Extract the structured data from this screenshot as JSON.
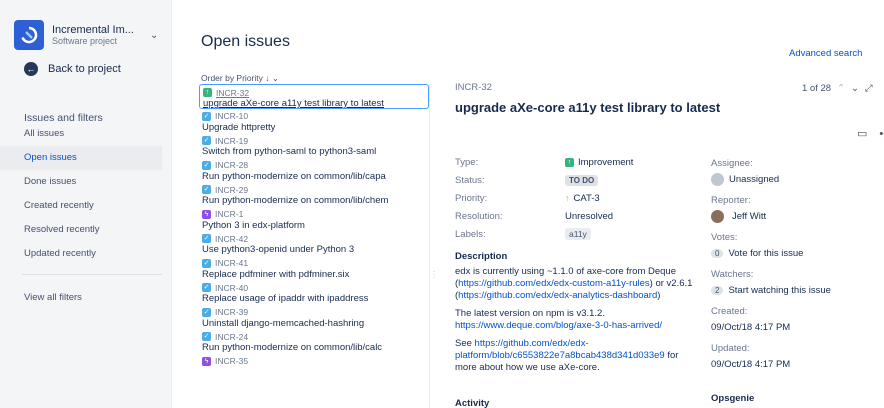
{
  "sidebar": {
    "project_name": "Incremental Im...",
    "project_type": "Software project",
    "back_label": "Back to project",
    "heading": "Issues and filters",
    "items": [
      {
        "label": "All issues",
        "active": false
      },
      {
        "label": "Open issues",
        "active": true
      },
      {
        "label": "Done issues",
        "active": false
      },
      {
        "label": "Created recently",
        "active": false
      },
      {
        "label": "Resolved recently",
        "active": false
      },
      {
        "label": "Updated recently",
        "active": false
      }
    ],
    "view_all": "View all filters"
  },
  "main": {
    "title": "Open issues",
    "advanced_search": "Advanced search",
    "order_by": "Order by Priority ↓ ⌄"
  },
  "issues": [
    {
      "key": "INCR-32",
      "summary": "upgrade aXe-core a11y test library to latest",
      "type": "improvement"
    },
    {
      "key": "INCR-10",
      "summary": "Upgrade httpretty",
      "type": "task"
    },
    {
      "key": "INCR-19",
      "summary": "Switch from python-saml to python3-saml",
      "type": "task"
    },
    {
      "key": "INCR-28",
      "summary": "Run python-modernize on common/lib/capa",
      "type": "task"
    },
    {
      "key": "INCR-29",
      "summary": "Run python-modernize on common/lib/chem",
      "type": "task"
    },
    {
      "key": "INCR-1",
      "summary": "Python 3 in edx-platform",
      "type": "epic"
    },
    {
      "key": "INCR-42",
      "summary": "Use python3-openid under Python 3",
      "type": "task"
    },
    {
      "key": "INCR-41",
      "summary": "Replace pdfminer with pdfminer.six",
      "type": "task"
    },
    {
      "key": "INCR-40",
      "summary": "Replace usage of ipaddr with ipaddress",
      "type": "task"
    },
    {
      "key": "INCR-39",
      "summary": "Uninstall django-memcached-hashring",
      "type": "task"
    },
    {
      "key": "INCR-24",
      "summary": "Run python-modernize on common/lib/calc",
      "type": "task"
    },
    {
      "key": "INCR-35",
      "summary": "",
      "type": "epic"
    }
  ],
  "detail": {
    "key": "INCR-32",
    "title": "upgrade aXe-core a11y test library to latest",
    "nav_count": "1 of 28",
    "fields": {
      "type_label": "Type:",
      "type_value": "Improvement",
      "status_label": "Status:",
      "status_value": "TO DO",
      "priority_label": "Priority:",
      "priority_value": "CAT-3",
      "resolution_label": "Resolution:",
      "resolution_value": "Unresolved",
      "labels_label": "Labels:",
      "labels_value": "a11y"
    },
    "description_heading": "Description",
    "description": {
      "p1_text1": "edx is currently using ~1.1.0 of axe-core from Deque (",
      "p1_link1": "https://github.com/edx/edx-custom-a11y-rules",
      "p1_text2": ") or v2.6.1 (",
      "p1_link2": "https://github.com/edx/edx-analytics-dashboard",
      "p1_text3": ")",
      "p2_text": "The latest version on npm is v3.1.2.",
      "p2_link": "https://www.deque.com/blog/axe-3-0-has-arrived/",
      "p3_text1": "See ",
      "p3_link": "https://github.com/edx/edx-platform/blob/c6553822e7a8bcab438d341d033e9",
      "p3_text2": " for more about how we use aXe-core."
    },
    "activity_heading": "Activity",
    "side": {
      "assignee_label": "Assignee:",
      "assignee_value": "Unassigned",
      "reporter_label": "Reporter:",
      "reporter_value": "Jeff Witt",
      "votes_label": "Votes:",
      "votes_count": "0",
      "votes_text": "Vote for this issue",
      "watchers_label": "Watchers:",
      "watchers_count": "2",
      "watchers_text": "Start watching this issue",
      "created_label": "Created:",
      "created_value": "09/Oct/18 4:17 PM",
      "updated_label": "Updated:",
      "updated_value": "09/Oct/18 4:17 PM",
      "opsgenie": "Opsgenie"
    }
  }
}
